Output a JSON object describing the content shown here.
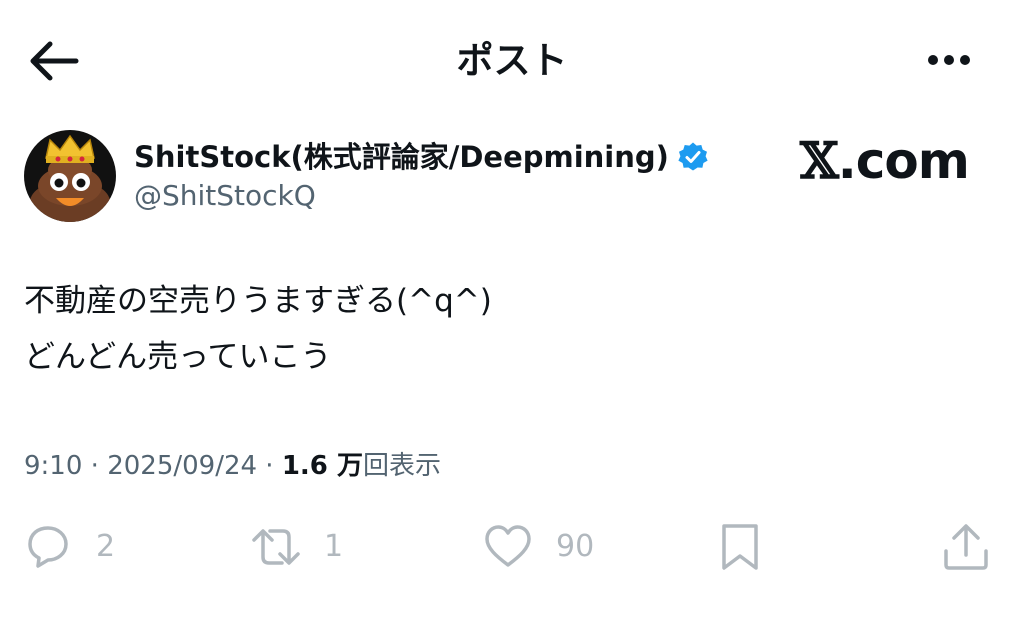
{
  "header": {
    "title": "ポスト",
    "back_icon": "arrow-left-icon",
    "more_icon": "ellipsis-icon"
  },
  "author": {
    "display_name": "ShitStock(株式評論家/Deepmining)",
    "handle": "@ShitStockQ",
    "verified_icon": "verified-badge-icon",
    "verified_color": "#1d9bf0"
  },
  "brand": {
    "x_glyph": "𝕏",
    "domain": ".com"
  },
  "tweet": {
    "lines": [
      "不動産の空売りうますぎる(^q^)",
      "どんどん売っていこう"
    ]
  },
  "meta": {
    "time": "9:10",
    "sep1": " · ",
    "date": "2025/09/24",
    "sep2": " · ",
    "views": "1.6 万",
    "views_label": "回表示"
  },
  "actions": {
    "reply": {
      "icon": "reply-icon",
      "count": "2"
    },
    "repost": {
      "icon": "repost-icon",
      "count": "1"
    },
    "like": {
      "icon": "heart-icon",
      "count": "90"
    },
    "bookmark": {
      "icon": "bookmark-icon"
    },
    "share": {
      "icon": "share-icon"
    }
  },
  "colors": {
    "text": "#0f1419",
    "secondary": "#536471"
  }
}
